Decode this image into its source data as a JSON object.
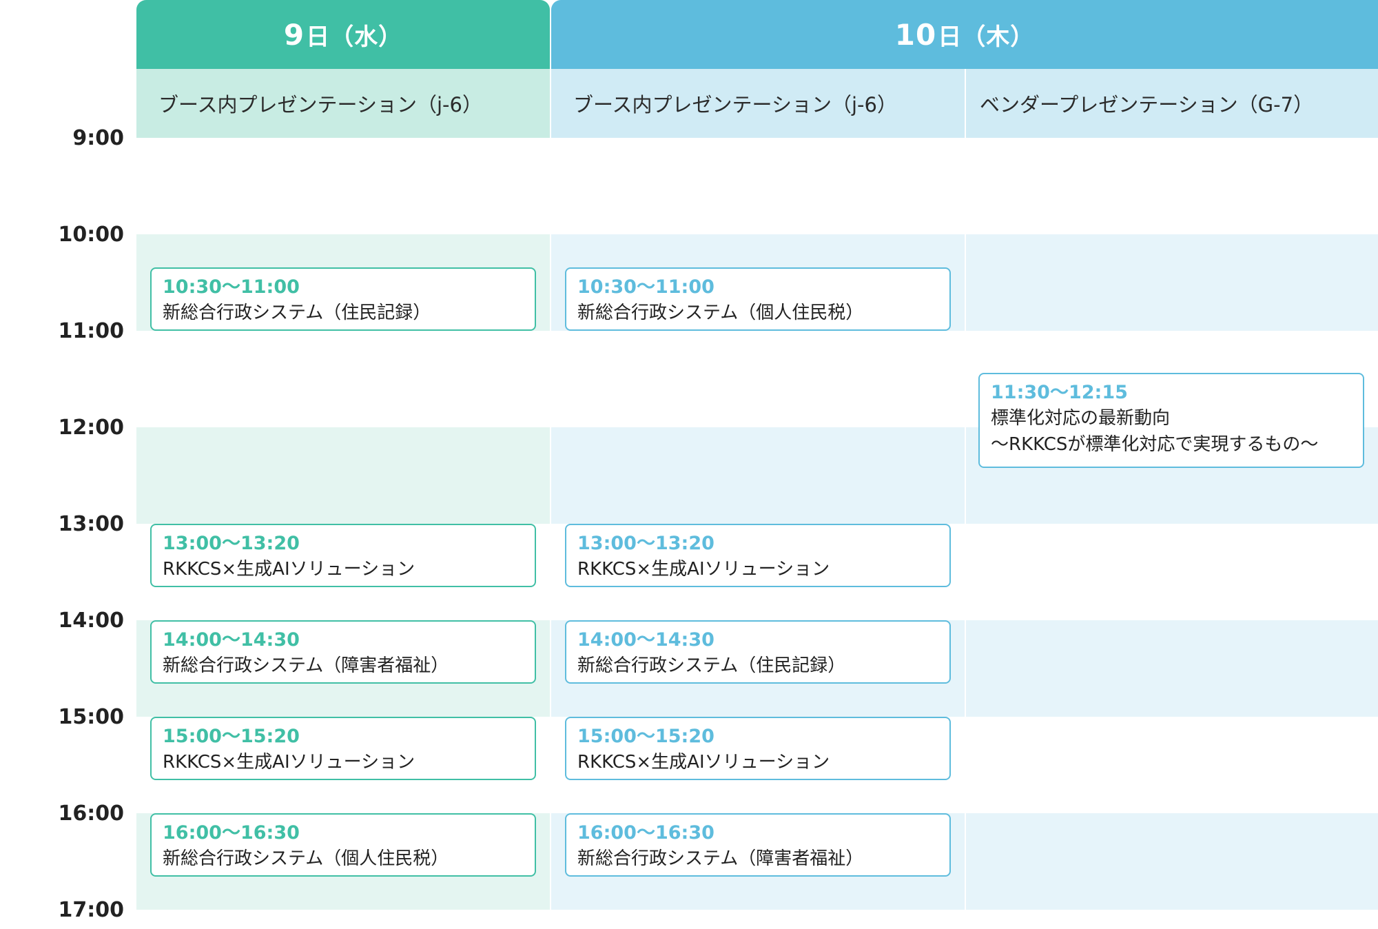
{
  "colors": {
    "green": "#40bfa5",
    "blue": "#5ebcdd",
    "green_sub": "#c8ece3",
    "blue_sub": "#d0ebf5",
    "green_band": "#e4f5f1",
    "blue_band": "#e6f4fa"
  },
  "days": [
    {
      "num": "9",
      "suffix": "日（水）"
    },
    {
      "num": "10",
      "suffix": "日（木）"
    }
  ],
  "columns": [
    {
      "header": "ブース内プレゼンテーション（j-6）"
    },
    {
      "header": "ブース内プレゼンテーション（j-6）"
    },
    {
      "header": "ベンダープレゼンテーション（G-7）"
    }
  ],
  "times": [
    "9:00",
    "10:00",
    "11:00",
    "12:00",
    "13:00",
    "14:00",
    "15:00",
    "16:00",
    "17:00"
  ],
  "sessions": {
    "c0s1": {
      "time": "10:30〜11:00",
      "title": "新総合行政システム（住民記録）"
    },
    "c0s2": {
      "time": "13:00〜13:20",
      "title": "RKKCS×生成AIソリューション"
    },
    "c0s3": {
      "time": "14:00〜14:30",
      "title": "新総合行政システム（障害者福祉）"
    },
    "c0s4": {
      "time": "15:00〜15:20",
      "title": "RKKCS×生成AIソリューション"
    },
    "c0s5": {
      "time": "16:00〜16:30",
      "title": "新総合行政システム（個人住民税）"
    },
    "c1s1": {
      "time": "10:30〜11:00",
      "title": "新総合行政システム（個人住民税）"
    },
    "c1s2": {
      "time": "13:00〜13:20",
      "title": "RKKCS×生成AIソリューション"
    },
    "c1s3": {
      "time": "14:00〜14:30",
      "title": "新総合行政システム（住民記録）"
    },
    "c1s4": {
      "time": "15:00〜15:20",
      "title": "RKKCS×生成AIソリューション"
    },
    "c1s5": {
      "time": "16:00〜16:30",
      "title": "新総合行政システム（障害者福祉）"
    },
    "c2s1": {
      "time": "11:30〜12:15",
      "title": "標準化対応の最新動向",
      "title2": "〜RKKCSが標準化対応で実現するもの〜"
    }
  }
}
